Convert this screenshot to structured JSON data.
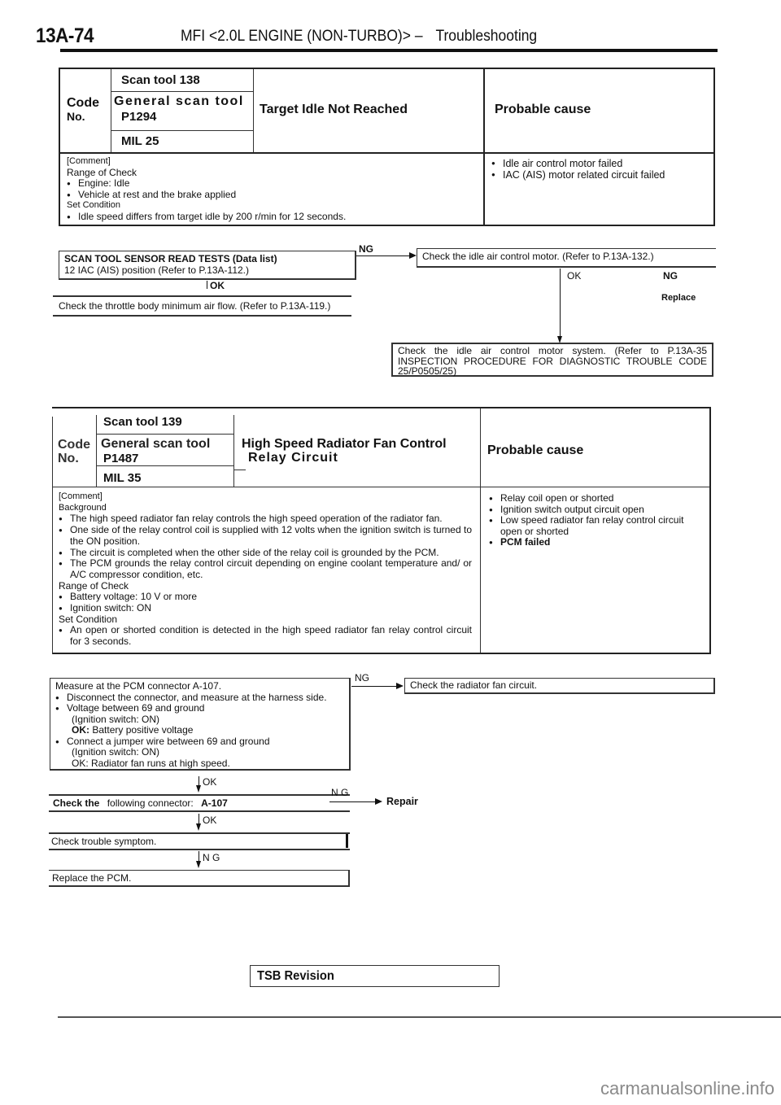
{
  "header": {
    "page_code": "13A-74",
    "title_prefix": "MFI <2.0L ENGINE (NON-TURBO)> –",
    "title_section": "Troubleshooting"
  },
  "dtc1": {
    "code_label_1": "Code",
    "code_label_2": "No.",
    "scan_tool": "Scan tool 138",
    "general_scan_tool": "General scan tool",
    "p_code": "P1294",
    "mil": "MIL 25",
    "title": "Target Idle Not Reached",
    "probable_cause_heading": "Probable cause",
    "comment_heading": "[Comment]",
    "range_heading": "Range of Check",
    "range_items": [
      "Engine: Idle",
      "Vehicle at rest and the brake applied"
    ],
    "set_heading": "Set Condition",
    "set_items": [
      "Idle speed differs from target idle by 200 r/min for 12 seconds."
    ],
    "causes": [
      "Idle air control motor failed",
      "IAC (AIS) motor related circuit failed"
    ]
  },
  "flow1": {
    "step1_line1": "SCAN TOOL SENSOR READ TESTS (Data list)",
    "step1_line2": "12 IAC (AIS) position (Refer to P.13A-112.)",
    "ng_label": "NG",
    "ok_label": "OK",
    "step1_ng": "Check the idle air control motor. (Refer to P.13A-132.)",
    "step1_ok": "Check the throttle body minimum air flow. (Refer to P.13A-119.)",
    "motor_ok_label": "OK",
    "motor_ng_label": "NG",
    "motor_ng_action": "Replace",
    "motor_ok_action": "Check the idle air control motor system. (Refer to P.13A-35 INSPECTION PROCEDURE FOR DIAGNOSTIC TROUBLE CODE 25/P0505/25)"
  },
  "dtc2": {
    "code_label_1": "Code",
    "code_label_2": "No.",
    "scan_tool": "Scan tool 139",
    "general_scan_tool": "General scan tool",
    "p_code": "P1487",
    "mil": "MIL 35",
    "title_line1": "High Speed Radiator Fan Control",
    "title_line2": "Relay Circuit",
    "probable_cause_heading": "Probable cause",
    "comment_heading": "[Comment]",
    "background_heading": "Background",
    "background_items": [
      "The high speed radiator fan relay controls the high speed operation of the radiator fan.",
      "One side of the relay control coil is supplied with 12 volts when the ignition switch is turned to the ON position.",
      "The circuit is completed when the other side of the relay coil is grounded by the PCM.",
      "The PCM grounds the relay control circuit depending on engine coolant temperature and/ or A/C compressor condition, etc."
    ],
    "range_heading": "Range of Check",
    "range_items": [
      "Battery voltage: 10 V or more",
      "Ignition switch: ON"
    ],
    "set_heading": "Set Condition",
    "set_items": [
      "An open or shorted condition is detected in the high speed radiator fan relay control circuit for 3 seconds."
    ],
    "causes": [
      "Relay coil open or shorted",
      "Ignition switch output circuit open",
      "Low speed radiator fan relay control circuit open or shorted",
      "PCM failed"
    ]
  },
  "flow2": {
    "measure_title": "Measure at the PCM connector A-107.",
    "measure_items": [
      "Disconnect the connector, and measure at the harness side.",
      "Voltage between 69 and ground"
    ],
    "measure_sub1": "(Ignition switch: ON)",
    "measure_ok1_label": "OK:",
    "measure_ok1": "Battery positive voltage",
    "measure_item3": "Connect a jumper wire between 69 and ground",
    "measure_sub2": "(Ignition switch: ON)",
    "measure_ok2": "OK: Radiator fan runs at high speed.",
    "ng_label_1": "NG",
    "ng_action_1": "Check the radiator fan circuit.",
    "ok_label_1": "OK",
    "connector_check_bold": "Check the",
    "connector_check_rest": "following connector:",
    "connector_id": "A-107",
    "ng_label_2": "N G",
    "ng_action_2": "Repair",
    "ok_label_2": "OK",
    "symptom_check": "Check trouble symptom.",
    "ng_label_3": "N G",
    "replace_pcm": "Replace the PCM."
  },
  "footer": {
    "tsb_revision": "TSB Revision",
    "watermark": "carmanualsonline.info"
  }
}
